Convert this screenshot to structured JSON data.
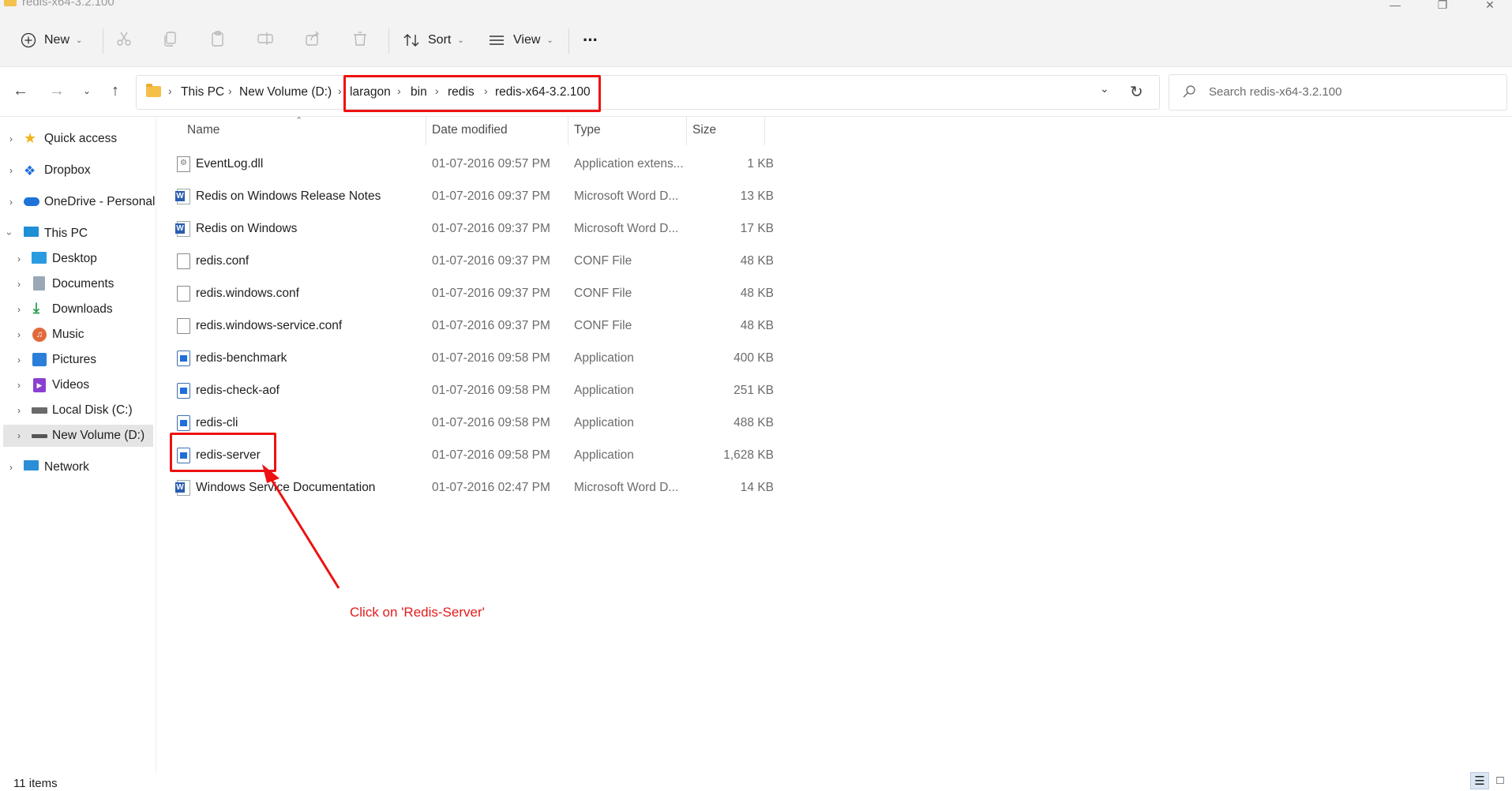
{
  "window": {
    "title": "redis-x64-3.2.100",
    "minimize_glyph": "—",
    "restore_glyph": "❐",
    "close_glyph": "✕"
  },
  "commandbar": {
    "new_label": "New",
    "sort_label": "Sort",
    "view_label": "View",
    "more_glyph": "···",
    "icons": [
      "cut-icon",
      "copy-icon",
      "paste-icon",
      "rename-icon",
      "share-icon",
      "delete-icon"
    ]
  },
  "address": {
    "crumbs": [
      "This PC",
      "New Volume (D:)",
      "laragon",
      "bin",
      "redis",
      "redis-x64-3.2.100"
    ],
    "search_placeholder": "Search redis-x64-3.2.100"
  },
  "nav": {
    "items": [
      {
        "label": "Quick access",
        "icon": "star-icon",
        "color": "#f2b21b"
      },
      {
        "label": "Dropbox",
        "icon": "dropbox-icon",
        "color": "#1e6fd9"
      },
      {
        "label": "OneDrive - Personal",
        "icon": "cloud-icon",
        "color": "#1e73d8"
      },
      {
        "label": "This PC",
        "icon": "monitor-icon",
        "color": "#1f8fd6"
      },
      {
        "label": "Desktop",
        "icon": "desktop-icon",
        "color": "#2a9be0"
      },
      {
        "label": "Documents",
        "icon": "documents-icon",
        "color": "#8a9aaa"
      },
      {
        "label": "Downloads",
        "icon": "download-icon",
        "color": "#2a9a4a"
      },
      {
        "label": "Music",
        "icon": "music-icon",
        "color": "#e06a3c"
      },
      {
        "label": "Pictures",
        "icon": "pictures-icon",
        "color": "#2a7fd9"
      },
      {
        "label": "Videos",
        "icon": "videos-icon",
        "color": "#8a3fd0"
      },
      {
        "label": "Local Disk (C:)",
        "icon": "windows-drive-icon",
        "color": "#6a6a6a"
      },
      {
        "label": "New Volume (D:)",
        "icon": "drive-icon",
        "color": "#555555"
      },
      {
        "label": "Network",
        "icon": "network-icon",
        "color": "#2a8fd6"
      }
    ]
  },
  "columns": {
    "name": "Name",
    "date": "Date modified",
    "type": "Type",
    "size": "Size"
  },
  "files": [
    {
      "name": "EventLog.dll",
      "date": "01-07-2016 09:57 PM",
      "type": "Application extens...",
      "size": "1 KB",
      "icon": "dll-icon"
    },
    {
      "name": "Redis on Windows Release Notes",
      "date": "01-07-2016 09:37 PM",
      "type": "Microsoft Word D...",
      "size": "13 KB",
      "icon": "word-doc-icon"
    },
    {
      "name": "Redis on Windows",
      "date": "01-07-2016 09:37 PM",
      "type": "Microsoft Word D...",
      "size": "17 KB",
      "icon": "word-doc-icon"
    },
    {
      "name": "redis.conf",
      "date": "01-07-2016 09:37 PM",
      "type": "CONF File",
      "size": "48 KB",
      "icon": "file-icon"
    },
    {
      "name": "redis.windows.conf",
      "date": "01-07-2016 09:37 PM",
      "type": "CONF File",
      "size": "48 KB",
      "icon": "file-icon"
    },
    {
      "name": "redis.windows-service.conf",
      "date": "01-07-2016 09:37 PM",
      "type": "CONF File",
      "size": "48 KB",
      "icon": "file-icon"
    },
    {
      "name": "redis-benchmark",
      "date": "01-07-2016 09:58 PM",
      "type": "Application",
      "size": "400 KB",
      "icon": "app-icon"
    },
    {
      "name": "redis-check-aof",
      "date": "01-07-2016 09:58 PM",
      "type": "Application",
      "size": "251 KB",
      "icon": "app-icon"
    },
    {
      "name": "redis-cli",
      "date": "01-07-2016 09:58 PM",
      "type": "Application",
      "size": "488 KB",
      "icon": "app-icon"
    },
    {
      "name": "redis-server",
      "date": "01-07-2016 09:58 PM",
      "type": "Application",
      "size": "1,628 KB",
      "icon": "app-icon"
    },
    {
      "name": "Windows Service Documentation",
      "date": "01-07-2016 02:47 PM",
      "type": "Microsoft Word D...",
      "size": "14 KB",
      "icon": "word-doc-icon"
    }
  ],
  "annotation": {
    "text": "Click on 'Redis-Server'",
    "color": "#e31b1b"
  },
  "status": {
    "item_count": "11 items"
  }
}
